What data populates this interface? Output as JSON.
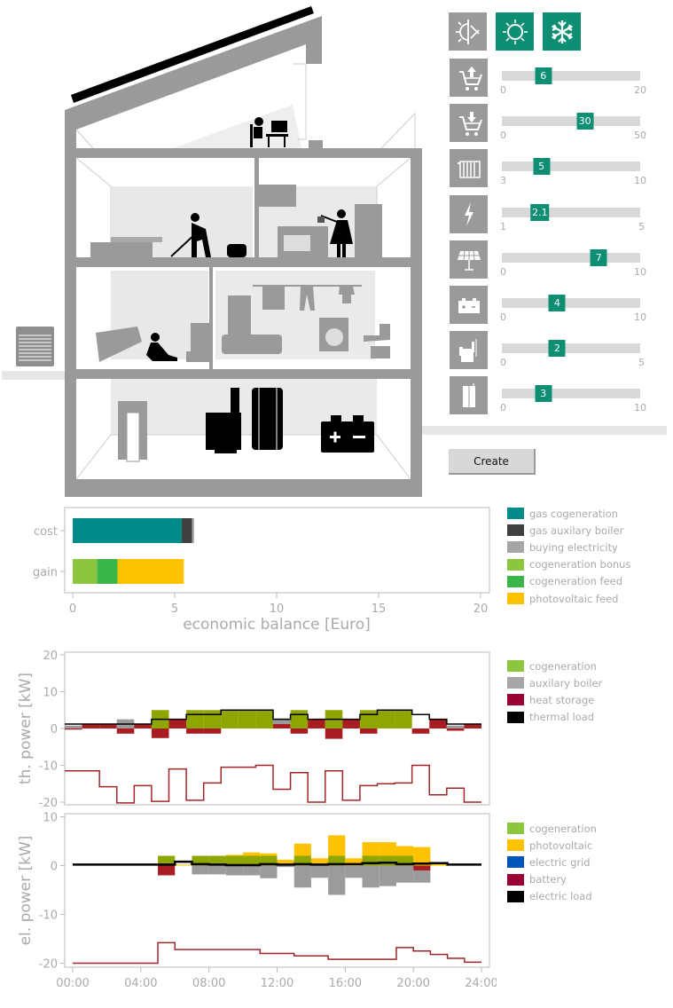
{
  "season_buttons": [
    {
      "name": "transition-season",
      "icon": "sun-snowflake-icon",
      "active": false
    },
    {
      "name": "summer",
      "icon": "sun-icon",
      "active": true
    },
    {
      "name": "winter",
      "icon": "snowflake-icon",
      "active": true
    }
  ],
  "sliders": [
    {
      "name": "electricity-buy-price",
      "icon": "cart-up-icon",
      "min": "0",
      "max": "20",
      "value": "6"
    },
    {
      "name": "electricity-sell-price",
      "icon": "cart-down-icon",
      "min": "0",
      "max": "50",
      "value": "30"
    },
    {
      "name": "heating-demand",
      "icon": "radiator-icon",
      "min": "3",
      "max": "10",
      "value": "5"
    },
    {
      "name": "electric-demand",
      "icon": "lightning-icon",
      "min": "1",
      "max": "5",
      "value": "2.1"
    },
    {
      "name": "photovoltaic-size",
      "icon": "solar-panel-icon",
      "min": "0",
      "max": "10",
      "value": "7"
    },
    {
      "name": "battery-size",
      "icon": "battery-icon",
      "min": "0",
      "max": "10",
      "value": "4"
    },
    {
      "name": "cogeneration-size",
      "icon": "chp-unit-icon",
      "min": "0",
      "max": "5",
      "value": "2"
    },
    {
      "name": "heat-storage-size",
      "icon": "storage-tank-icon",
      "min": "0",
      "max": "10",
      "value": "3"
    }
  ],
  "create_button": {
    "label": "Create"
  },
  "colors": {
    "accent": "#0e8f74",
    "cogeneration_bar": "#8fa600",
    "storage_bar": "#a81c22",
    "aux_boiler_bar": "#9b9b9b",
    "photovoltaic_bar": "#ffc200",
    "battery_bar": "#a81c22",
    "grid_bar": "#9b9b9b",
    "soc_line": "#a0252a"
  },
  "chart_data": [
    {
      "type": "bar",
      "orientation": "horizontal-stacked",
      "title": "",
      "xlabel": "economic balance [Euro]",
      "xlim": [
        0,
        20
      ],
      "xticks": [
        "0",
        "5",
        "10",
        "15",
        "20"
      ],
      "categories": [
        "cost",
        "gain"
      ],
      "series": [
        {
          "name": "gas cogeneration",
          "color": "#008b8b",
          "values": [
            5.35,
            0
          ]
        },
        {
          "name": "gas auxilary boiler",
          "color": "#404040",
          "values": [
            0.5,
            0
          ]
        },
        {
          "name": "buying electricity",
          "color": "#a6a6a6",
          "values": [
            0.1,
            0
          ]
        },
        {
          "name": "cogeneration bonus",
          "color": "#8cc63f",
          "values": [
            0,
            1.2
          ]
        },
        {
          "name": "cogeneration feed",
          "color": "#39b54a",
          "values": [
            0,
            1.0
          ]
        },
        {
          "name": "photovoltaic feed",
          "color": "#ffc200",
          "values": [
            0,
            3.25
          ]
        }
      ],
      "legend_position": "right"
    },
    {
      "type": "step-stacked-bar",
      "ylabel": "th. power [kW]",
      "ylim": [
        -21,
        21
      ],
      "yticks": [
        "20",
        "10",
        "0",
        "-10",
        "-20"
      ],
      "x": [
        0,
        1,
        2,
        3,
        4,
        5,
        6,
        7,
        8,
        9,
        10,
        11,
        12,
        13,
        14,
        15,
        16,
        17,
        18,
        19,
        20,
        21,
        22,
        23
      ],
      "series": [
        {
          "name": "cogeneration",
          "legend_color": "#8cc63f",
          "values": [
            0,
            0,
            0,
            0,
            0,
            5,
            0,
            5,
            5,
            5,
            5,
            5,
            0,
            5,
            0,
            5,
            0,
            5,
            5,
            5,
            0,
            0,
            0,
            0
          ]
        },
        {
          "name": "auxilary boiler",
          "legend_color": "#a6a6a6",
          "values": [
            0.8,
            0,
            0,
            2.5,
            0,
            0,
            0,
            0,
            0,
            0,
            0,
            0,
            1.5,
            0,
            0,
            0,
            0,
            0,
            0,
            0,
            0,
            0,
            0.8,
            0
          ]
        },
        {
          "name": "heat storage",
          "legend_color": "#990033",
          "values": [
            -0.3,
            1.2,
            1.2,
            -1.4,
            1.2,
            -2.6,
            2.4,
            -1.4,
            -1.4,
            0.0,
            0.0,
            0.0,
            1.2,
            -1.4,
            2.4,
            -2.8,
            2.4,
            -1.4,
            0,
            0,
            -1.4,
            2.5,
            -0.6,
            1.2
          ]
        },
        {
          "name": "thermal load",
          "legend_color": "#000000",
          "values": [
            1.2,
            1.2,
            1.2,
            1.2,
            1.2,
            2.5,
            2.5,
            3.8,
            3.8,
            5,
            5,
            5,
            2.5,
            3.8,
            2.5,
            2.5,
            2.5,
            3.8,
            5,
            5,
            3.8,
            2.5,
            1.2,
            1.2
          ]
        }
      ],
      "storage_level_line": [
        -11.5,
        -11.5,
        -15.8,
        -20.2,
        -15.5,
        -19.8,
        -11,
        -19.5,
        -14.8,
        -10.5,
        -10.5,
        -10,
        -16.5,
        -12,
        -20,
        -11.5,
        -19.5,
        -15.5,
        -15,
        -14.8,
        -10,
        -18,
        -16.2,
        -20
      ],
      "legend_position": "right"
    },
    {
      "type": "step-stacked-bar",
      "ylabel": "el. power [kW]",
      "ylim": [
        -21,
        10.5
      ],
      "yticks": [
        "10",
        "0",
        "-10",
        "-20"
      ],
      "xlabel": "",
      "xticks": [
        "00:00",
        "04:00",
        "08:00",
        "12:00",
        "16:00",
        "20:00",
        "24:00"
      ],
      "x": [
        0,
        1,
        2,
        3,
        4,
        5,
        6,
        7,
        8,
        9,
        10,
        11,
        12,
        13,
        14,
        15,
        16,
        17,
        18,
        19,
        20,
        21,
        22,
        23
      ],
      "series": [
        {
          "name": "cogeneration",
          "legend_color": "#8cc63f",
          "values": [
            0,
            0,
            0,
            0,
            0,
            2,
            0,
            2,
            2,
            2,
            2,
            2,
            0,
            2,
            0,
            2,
            0,
            2,
            2,
            2,
            0,
            0,
            0,
            0
          ]
        },
        {
          "name": "photovoltaic",
          "legend_color": "#ffc200",
          "values": [
            0,
            0,
            0,
            0,
            0,
            0,
            0.2,
            0,
            0,
            0.2,
            0.7,
            0.5,
            1.2,
            2.5,
            1.5,
            4.2,
            1.5,
            2.8,
            2.8,
            2.0,
            3.8,
            0.3,
            0,
            0
          ]
        },
        {
          "name": "electric grid",
          "legend_color": "#0055bb",
          "values": [
            0,
            0,
            0,
            0,
            0,
            0,
            0,
            -1.8,
            -1.8,
            -2,
            -2,
            -2.6,
            -0.3,
            -4.5,
            -2.5,
            -6,
            -2.5,
            -4.5,
            -4.2,
            -3.5,
            -2.5,
            0,
            0,
            0
          ]
        },
        {
          "name": "battery",
          "legend_color": "#990033",
          "values": [
            0,
            0,
            0,
            0,
            0,
            -2,
            0,
            0,
            0,
            0,
            0,
            0,
            0,
            0,
            0,
            0,
            0,
            0,
            0,
            0,
            -1,
            0.3,
            0,
            0
          ]
        },
        {
          "name": "electric load",
          "legend_color": "#000000",
          "values": [
            0.2,
            0.2,
            0.2,
            0.2,
            0.2,
            0.2,
            0.8,
            0.3,
            0.2,
            0.1,
            0.1,
            0.3,
            0.2,
            0.3,
            0.2,
            0.3,
            0.3,
            0.5,
            0.6,
            0.3,
            0.4,
            0.5,
            0.2,
            0.2
          ]
        }
      ],
      "battery_level_line": [
        -20,
        -20,
        -20,
        -20,
        -20,
        -15.8,
        -17.2,
        -17.2,
        -17.2,
        -17.2,
        -17.2,
        -18,
        -18,
        -18.5,
        -18.5,
        -19.2,
        -19.2,
        -19.2,
        -19.2,
        -16.8,
        -17.5,
        -18.2,
        -19,
        -19.8
      ],
      "legend_position": "right"
    }
  ]
}
